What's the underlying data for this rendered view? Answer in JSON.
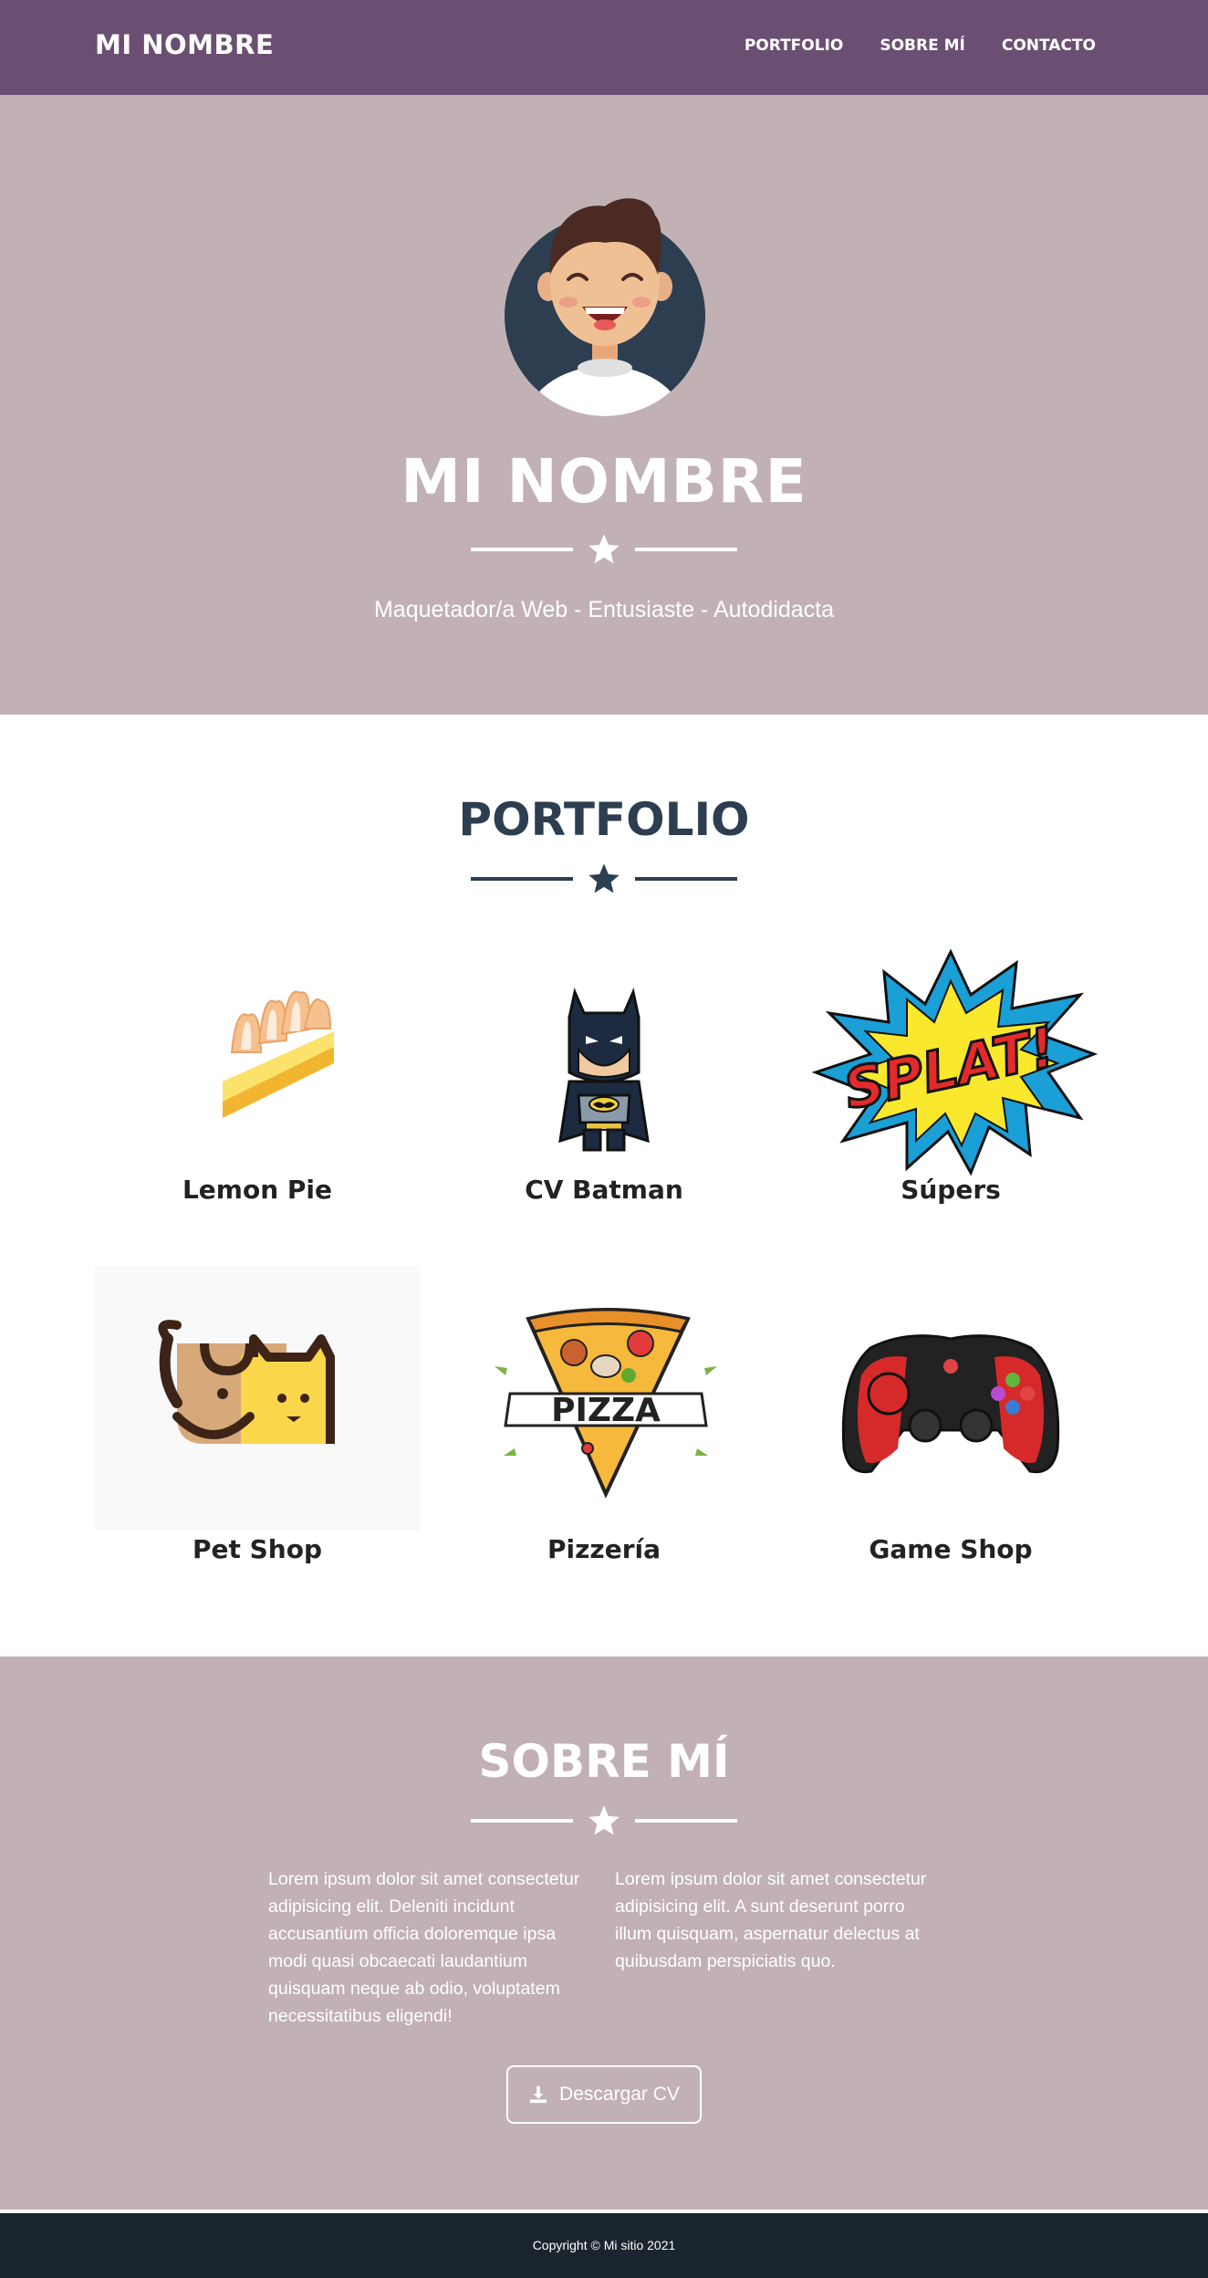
{
  "nav": {
    "brand": "MI NOMBRE",
    "links": [
      "PORTFOLIO",
      "SOBRE MÍ",
      "CONTACTO"
    ],
    "background": "#6b4f72"
  },
  "hero": {
    "title": "MI NOMBRE",
    "subtitle": "Maquetador/a Web - Entusiaste - Autodidacta",
    "background": "#c1b1b4",
    "avatar_icon": "smiling-man-avatar"
  },
  "portfolio": {
    "title": "PORTFOLIO",
    "accent": "#2c3e50",
    "items": [
      {
        "label": "Lemon Pie",
        "icon": "lemon-pie-slice"
      },
      {
        "label": "CV Batman",
        "icon": "batman-figure"
      },
      {
        "label": "Súpers",
        "icon": "splat-comic-burst"
      },
      {
        "label": "Pet Shop",
        "icon": "dog-cat-logo"
      },
      {
        "label": "Pizzería",
        "icon": "pizza-slice-logo"
      },
      {
        "label": "Game Shop",
        "icon": "gamepad-controller"
      }
    ]
  },
  "about": {
    "title": "SOBRE MÍ",
    "col1": "Lorem ipsum dolor sit amet consectetur adipisicing elit. Deleniti incidunt accusantium officia doloremque ipsa modi quasi obcaecati laudantium quisquam neque ab odio, voluptatem necessitatibus eligendi!",
    "col2": "Lorem ipsum dolor sit amet consectetur adipisicing elit. A sunt deserunt porro illum quisquam, aspernatur delectus at quibusdam perspiciatis quo.",
    "button_label": "Descargar CV",
    "button_icon": "download-icon"
  },
  "footer": {
    "text": "Copyright © Mi sitio 2021",
    "background": "#1a252f"
  }
}
